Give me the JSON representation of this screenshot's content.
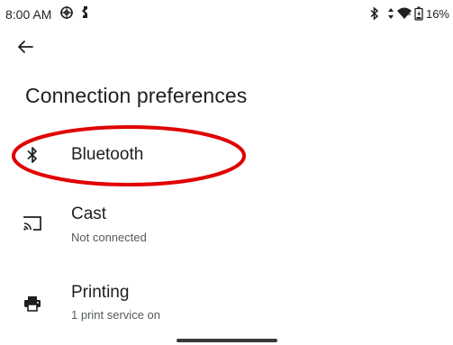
{
  "status_bar": {
    "time": "8:00 AM",
    "left_icons": [
      "settings-gear-icon",
      "notification-person-icon"
    ],
    "right_icons": [
      "bluetooth-icon",
      "data-arrows-icon",
      "wifi-icon",
      "battery-icon"
    ],
    "battery_text": "16%"
  },
  "header": {
    "back_icon": "arrow-back-icon",
    "title": "Connection preferences"
  },
  "items": [
    {
      "title": "Bluetooth",
      "summary": "",
      "icon": "bluetooth-icon"
    },
    {
      "title": "Cast",
      "summary": "Not connected",
      "icon": "cast-icon"
    },
    {
      "title": "Printing",
      "summary": "1 print service on",
      "icon": "printer-icon"
    }
  ],
  "colors": {
    "highlight": "#e00000",
    "text_primary": "#1f1f1f",
    "text_secondary": "#555a5e"
  }
}
